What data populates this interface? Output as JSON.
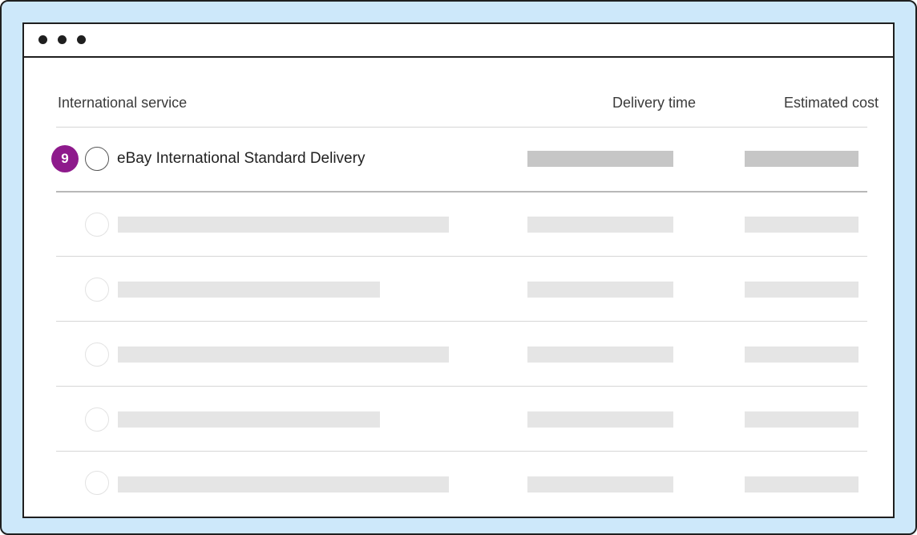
{
  "window": {
    "dots": [
      "dot",
      "dot",
      "dot"
    ]
  },
  "table": {
    "headers": {
      "service": "International service",
      "delivery_time": "Delivery time",
      "estimated_cost": "Estimated cost"
    },
    "highlighted_row": {
      "step_badge": "9",
      "service_name": "eBay International Standard Delivery"
    },
    "placeholder_rows": 5
  },
  "colors": {
    "background": "#cde8fa",
    "badge": "#8e1a8c",
    "placeholder_dark": "#c6c6c6",
    "placeholder_light": "#e5e5e5"
  }
}
